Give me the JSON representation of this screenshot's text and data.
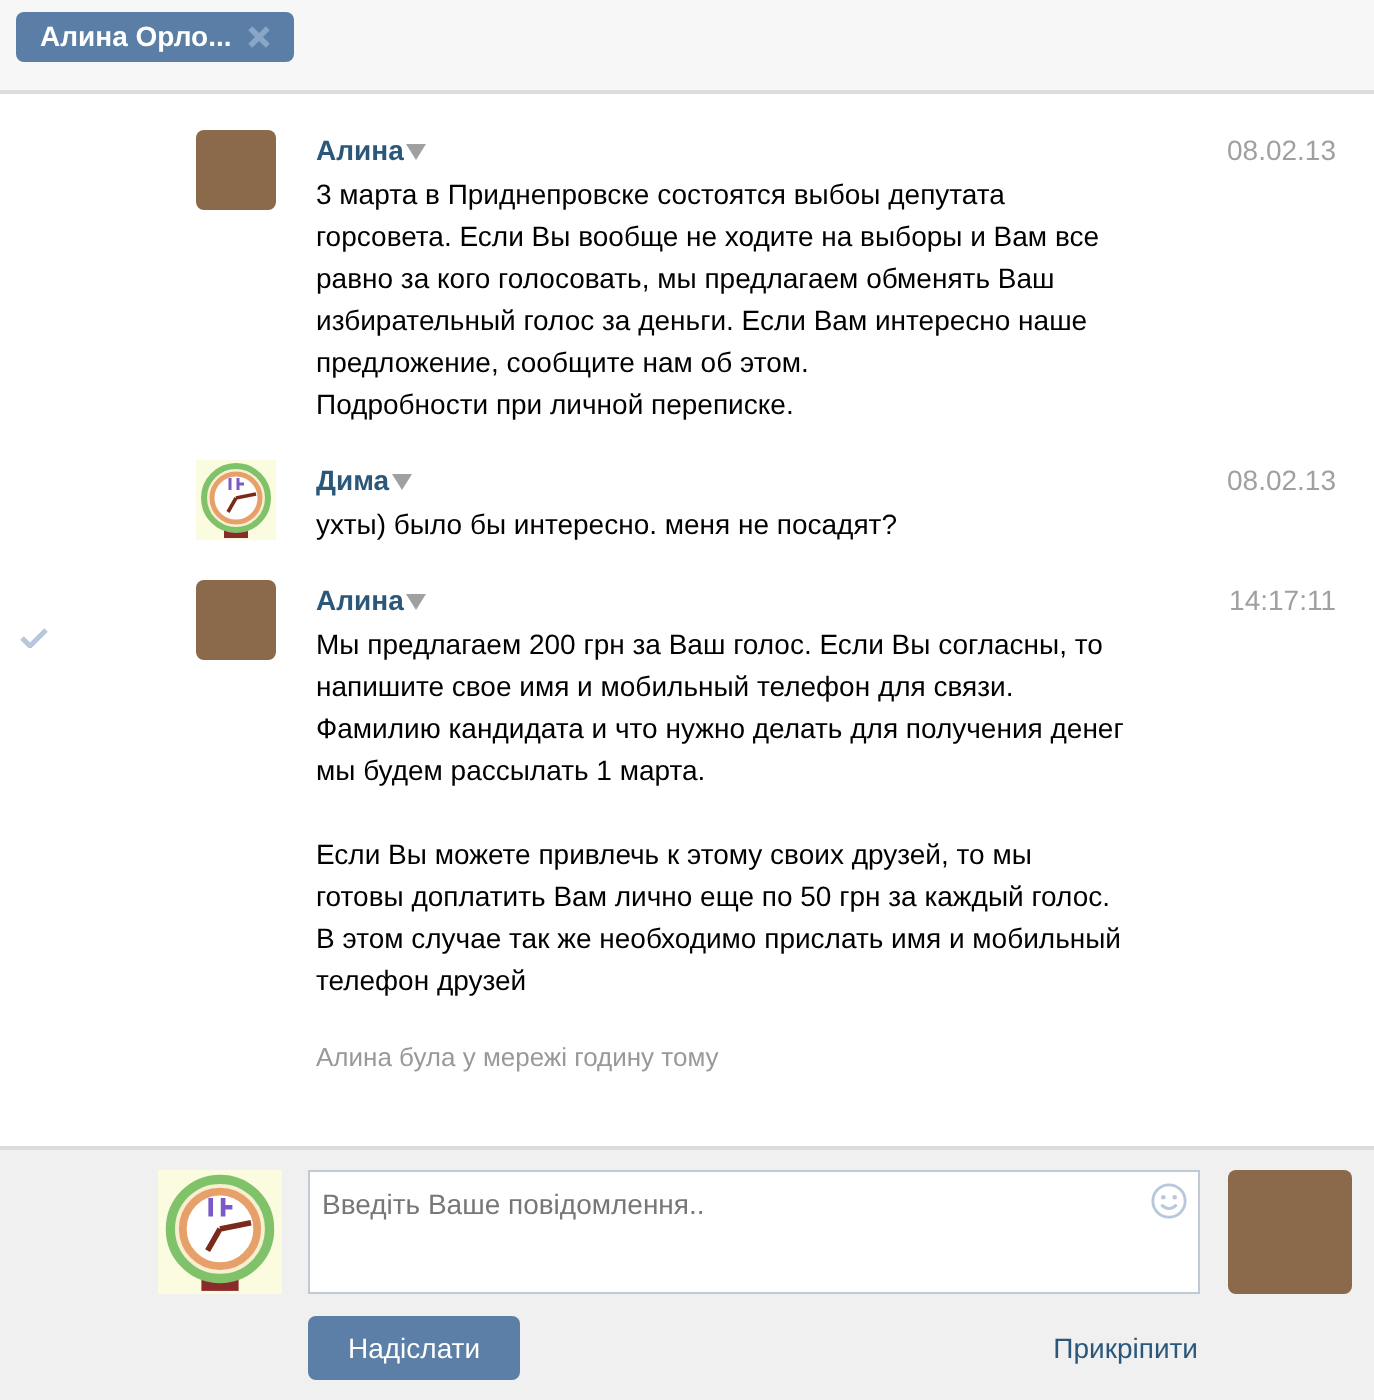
{
  "tab": {
    "label": "Алина Орло..."
  },
  "messages": [
    {
      "author": "Алина",
      "kind": "photo",
      "date": "08.02.13",
      "check_mark": false,
      "text": "3 марта в Приднепровске состоятся выбоы депутата горсовета. Если Вы вообще не ходите на выборы и Вам все равно за кого голосовать, мы предлагаем обменять Ваш избирательный голос за деньги. Если Вам интересно наше предложение, сообщите нам об этом.\nПодробности при личной переписке."
    },
    {
      "author": "Дима",
      "kind": "drawing",
      "date": "08.02.13",
      "check_mark": false,
      "text": "ухты) было бы интересно. меня не посадят?"
    },
    {
      "author": "Алина",
      "kind": "photo",
      "date": "14:17:11",
      "check_mark": true,
      "text": "Мы предлагаем 200 грн за Ваш голос. Если Вы согласны, то напишите свое имя и мобильный телефон для связи. Фамилию кандидата и что нужно делать для получения денег мы будем рассылать 1 марта.\n\nЕсли Вы можете привлечь к этому своих друзей, то мы готовы доплатить Вам лично еще по 50 грн за каждый голос. В этом случае так же необходимо прислать имя и мобильный телефон друзей"
    }
  ],
  "status": "Алина була у мережі годину тому",
  "composer": {
    "placeholder": "Введіть Ваше повідомлення..",
    "send": "Надіслати",
    "attach": "Прикріпити"
  }
}
